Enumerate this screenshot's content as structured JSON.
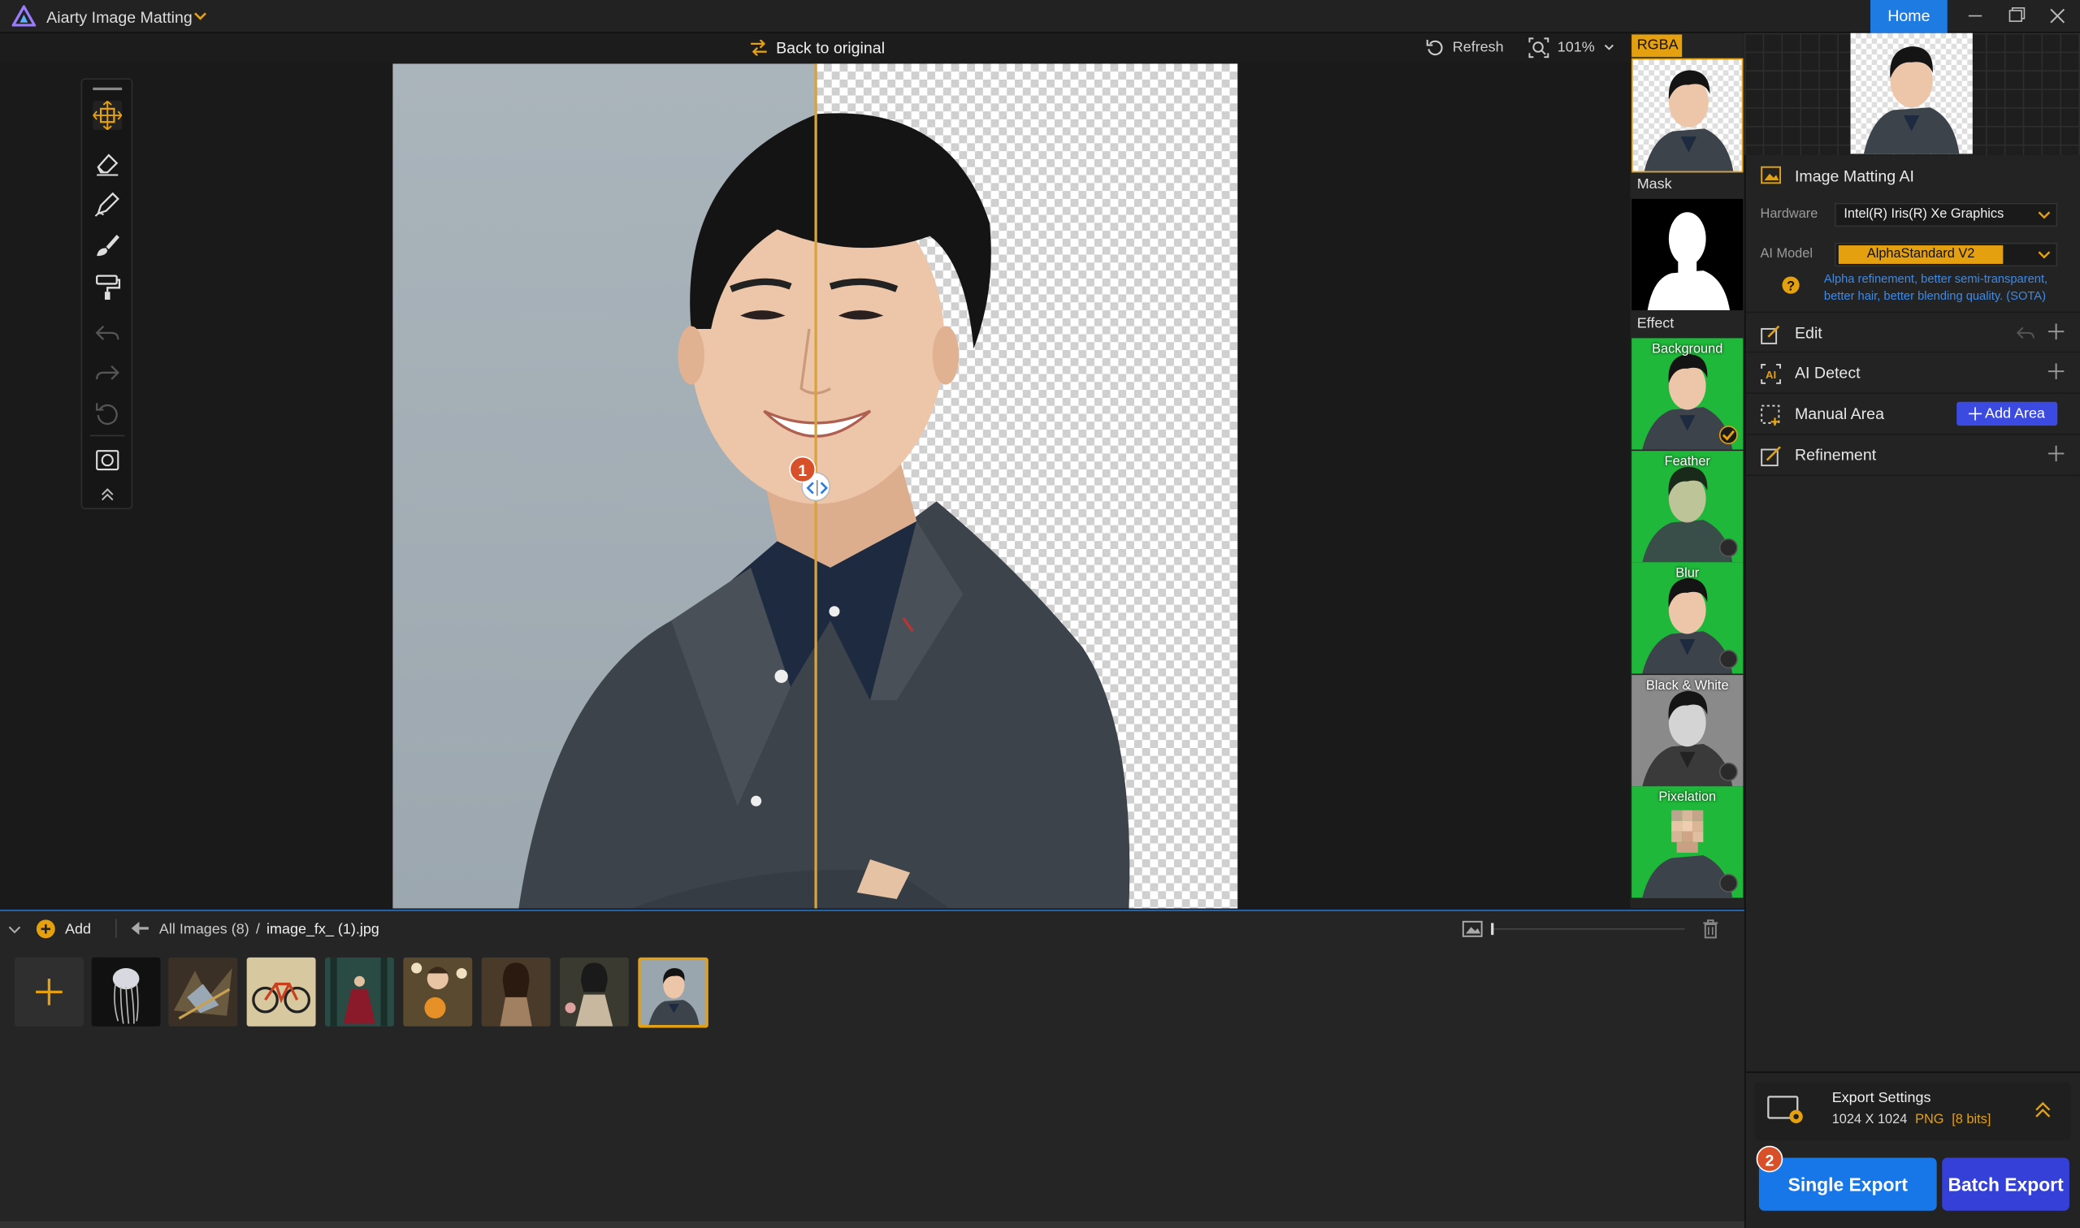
{
  "titlebar": {
    "app_title": "Aiarty Image Matting",
    "home_label": "Home"
  },
  "toolbar": {
    "back_to_original": "Back to original",
    "refresh": "Refresh",
    "zoom": "101%"
  },
  "markers": {
    "divider": "1",
    "export": "2"
  },
  "strip": {
    "rgba": "RGBA",
    "mask": "Mask",
    "effect": "Effect",
    "effects": [
      {
        "label": "Background",
        "selected": true
      },
      {
        "label": "Feather",
        "selected": false
      },
      {
        "label": "Blur",
        "selected": false
      },
      {
        "label": "Black & White",
        "selected": false
      },
      {
        "label": "Pixelation",
        "selected": false
      }
    ]
  },
  "panel": {
    "matting_title": "Image Matting AI",
    "hardware_label": "Hardware",
    "hardware_value": "Intel(R) Iris(R) Xe Graphics",
    "model_label": "AI Model",
    "model_value": "AlphaStandard  V2",
    "model_desc_1": "Alpha refinement, better semi-transparent,",
    "model_desc_2": "better hair, better blending quality. (SOTA)",
    "edit": "Edit",
    "ai_detect": "AI Detect",
    "manual_area": "Manual Area",
    "add_area": "Add Area",
    "refinement": "Refinement"
  },
  "export": {
    "settings_title": "Export Settings",
    "size": "1024 X 1024",
    "format": "PNG",
    "bits": "[8 bits]",
    "single": "Single Export",
    "batch": "Batch Export"
  },
  "bottom": {
    "add": "Add",
    "all_images": "All Images (8)",
    "separator": "/",
    "filename": "image_fx_ (1).jpg"
  },
  "colors": {
    "accent": "#e4a00e",
    "home_blue": "#1e7be2",
    "single_export": "#1877e8",
    "batch_export": "#3440d8",
    "effect_green": "#1fb83a"
  },
  "icons": [
    "app-logo-icon",
    "move-icon",
    "eraser-icon",
    "pen-icon",
    "brush-icon",
    "roller-icon",
    "undo-icon",
    "redo-icon",
    "reset-icon",
    "mask-view-icon",
    "collapse-up-icon",
    "refresh-icon",
    "zoom-icon",
    "swap-icon",
    "plus-icon",
    "trash-icon",
    "image-icon"
  ]
}
